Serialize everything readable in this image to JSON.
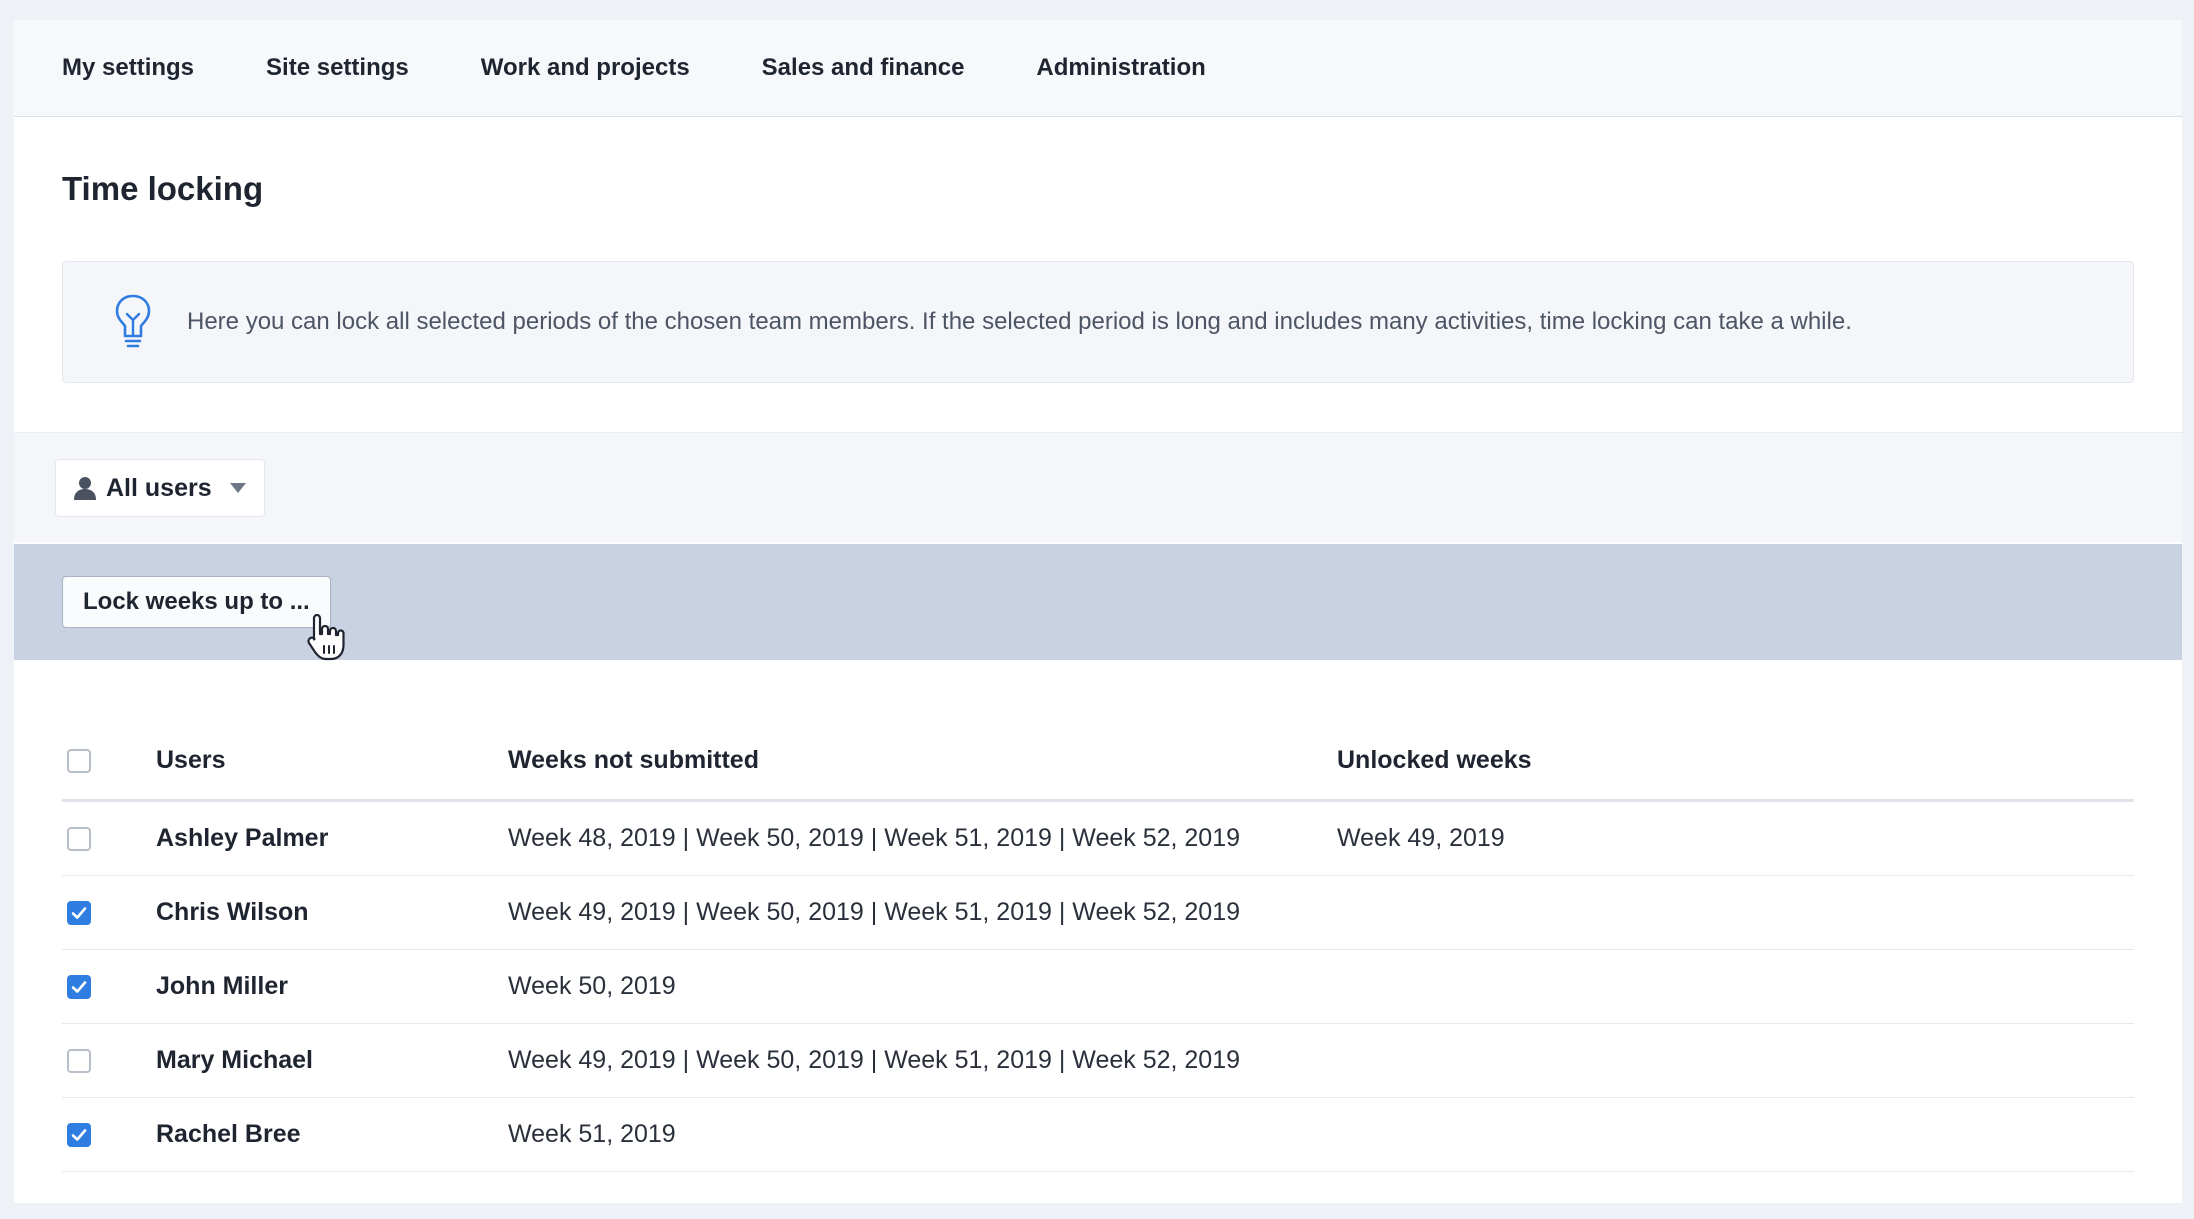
{
  "nav": {
    "tabs": [
      "My settings",
      "Site settings",
      "Work and projects",
      "Sales and finance",
      "Administration"
    ]
  },
  "page": {
    "title": "Time locking",
    "info": "Here you can lock all selected periods of the chosen team members. If the selected period is long and includes many activities, time locking can take a while."
  },
  "filter": {
    "user_select": "All users"
  },
  "actions": {
    "lock_button": "Lock weeks up to ..."
  },
  "table": {
    "headers": {
      "users": "Users",
      "weeks_not_submitted": "Weeks not submitted",
      "unlocked_weeks": "Unlocked weeks"
    },
    "rows": [
      {
        "user": "Ashley Palmer",
        "weeks": "Week 48, 2019 | Week 50, 2019 | Week 51, 2019 | Week 52, 2019",
        "unlocked": "Week 49, 2019",
        "checked": false
      },
      {
        "user": "Chris Wilson",
        "weeks": "Week 49, 2019 | Week 50, 2019 | Week 51, 2019 | Week 52, 2019",
        "unlocked": "",
        "checked": true
      },
      {
        "user": "John Miller",
        "weeks": "Week 50, 2019",
        "unlocked": "",
        "checked": true
      },
      {
        "user": "Mary Michael",
        "weeks": "Week 49, 2019 | Week 50, 2019 | Week 51, 2019 | Week 52, 2019",
        "unlocked": "",
        "checked": false
      },
      {
        "user": "Rachel Bree",
        "weeks": "Week 51, 2019",
        "unlocked": "",
        "checked": true
      }
    ]
  },
  "colors": {
    "accent": "#2f7de1",
    "action_bar": "#c9d2e2",
    "info_icon": "#2f7de1"
  },
  "icons": {
    "info": "lightbulb-icon",
    "user_select": "person-icon",
    "caret": "caret-down-icon",
    "cursor": "hand-cursor-icon"
  }
}
